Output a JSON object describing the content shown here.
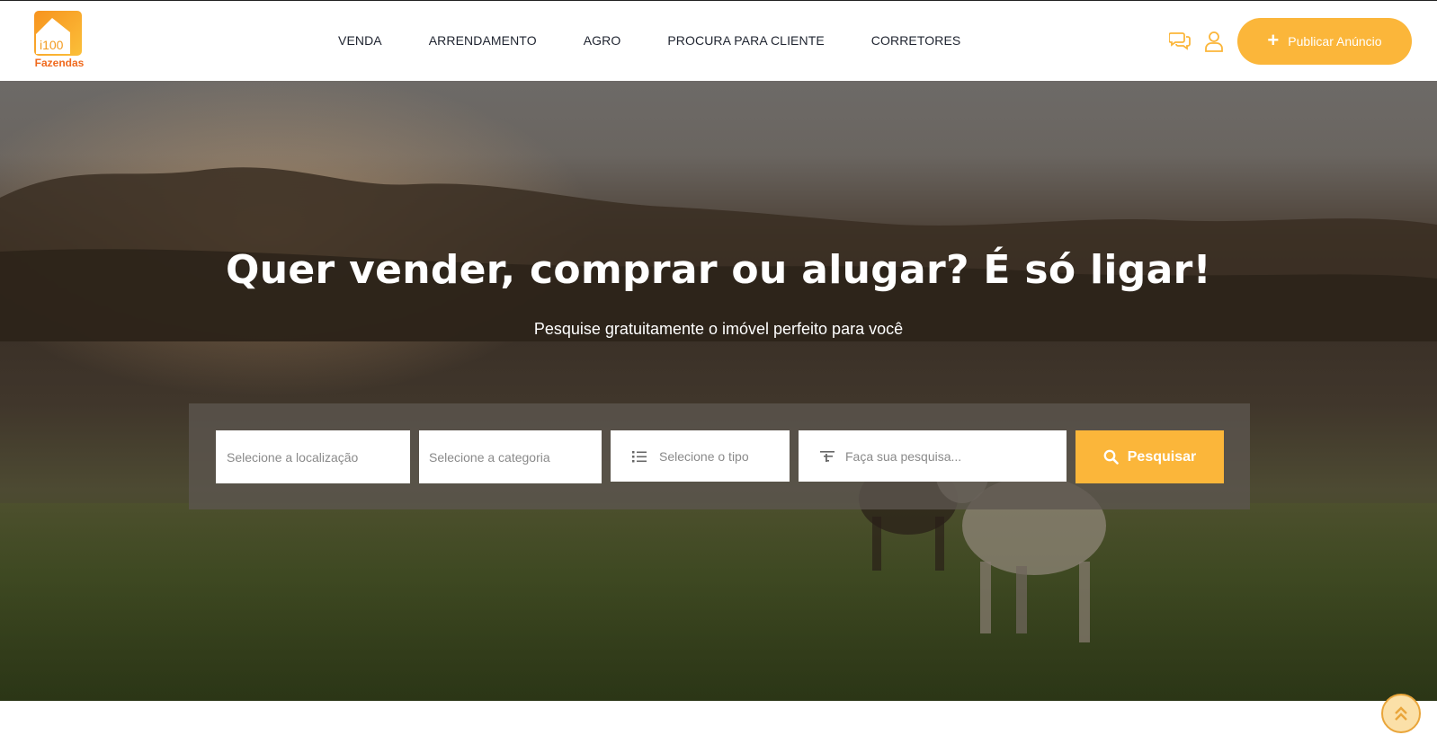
{
  "brand": {
    "logo_text": "Fazendas",
    "logo_mark": "i100",
    "accent": "#fbb63a",
    "logo_orange": "#f06a1e"
  },
  "nav": {
    "items": [
      {
        "label": "VENDA"
      },
      {
        "label": "ARRENDAMENTO"
      },
      {
        "label": "AGRO"
      },
      {
        "label": "PROCURA PARA CLIENTE"
      },
      {
        "label": "CORRETORES"
      }
    ]
  },
  "header_actions": {
    "chat_icon": "chat-bubbles-icon",
    "user_icon": "user-icon",
    "publish_label": "Publicar Anúncio"
  },
  "hero": {
    "title": "Quer vender, comprar ou alugar? É só ligar!",
    "subtitle": "Pesquise gratuitamente o imóvel perfeito para você"
  },
  "search": {
    "location_placeholder": "Selecione a localização",
    "category_placeholder": "Selecione a categoria",
    "type_placeholder": "Selecione o tipo",
    "query_placeholder": "Faça sua pesquisa...",
    "query_value": "",
    "button_label": "Pesquisar"
  },
  "scroll_top_icon": "double-chevron-up-icon"
}
